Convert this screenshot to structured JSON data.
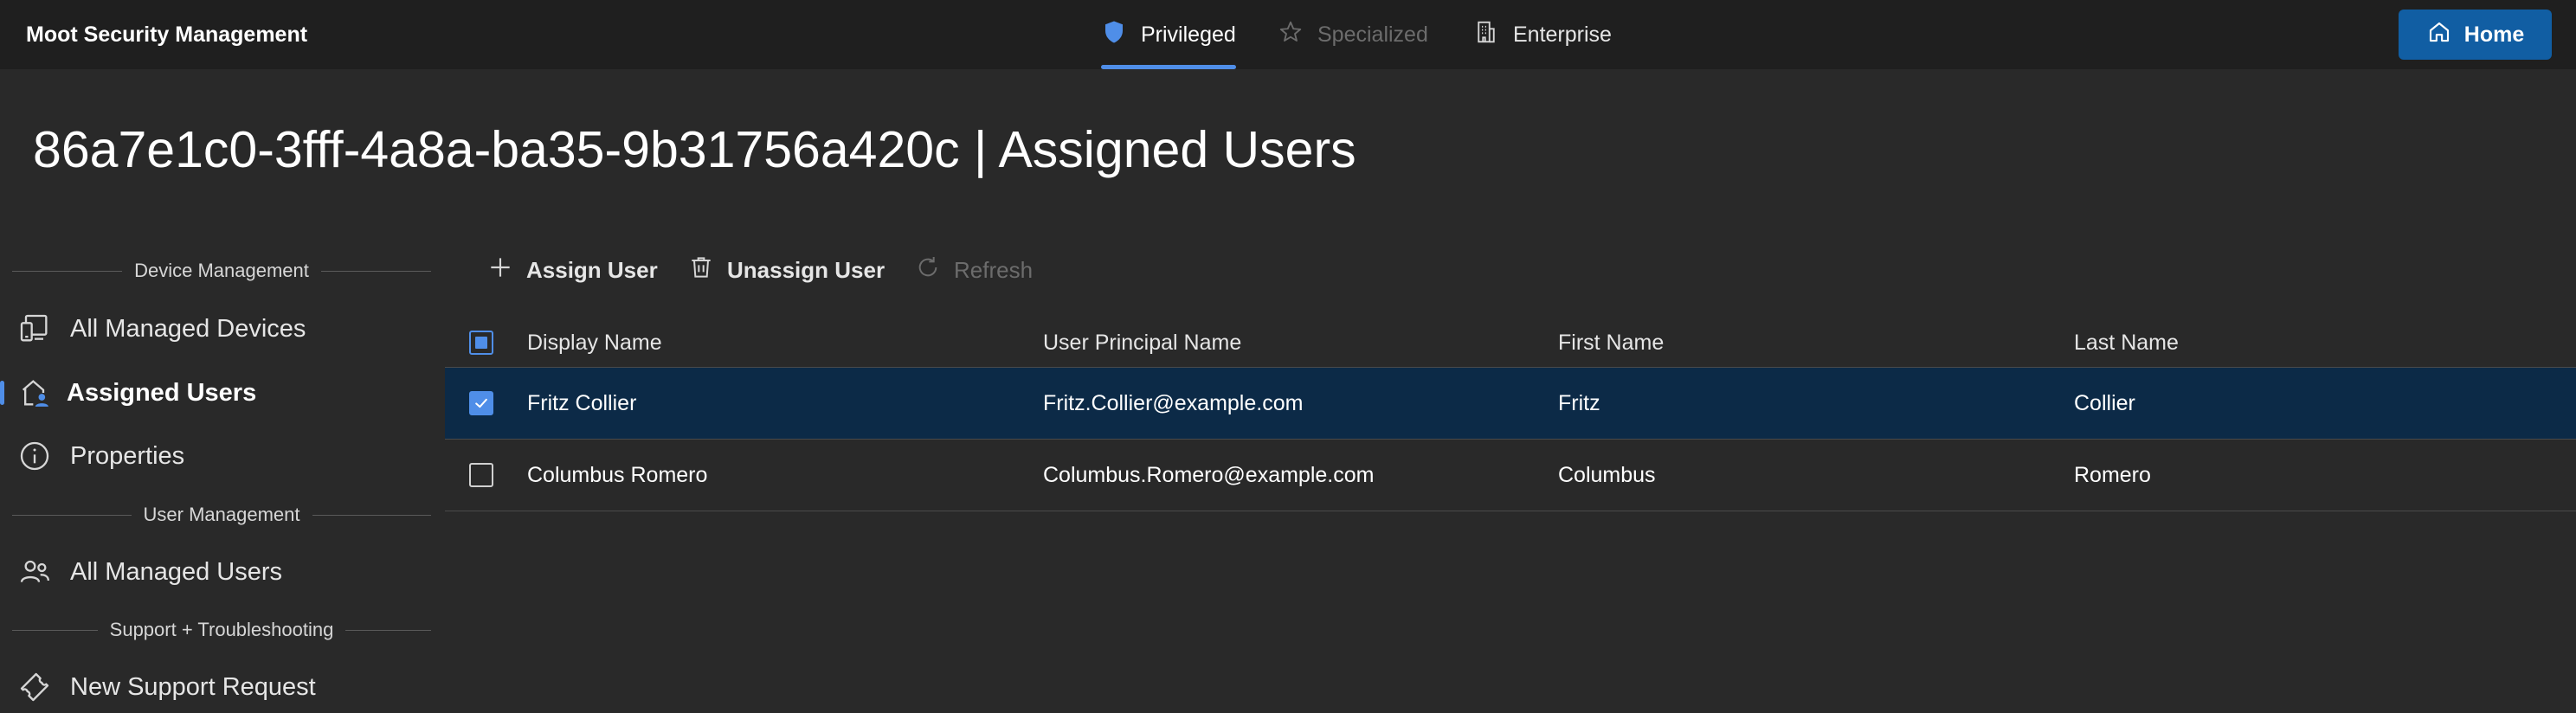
{
  "app": {
    "title": "Moot Security Management"
  },
  "tabs": [
    {
      "label": "Privileged",
      "state": "active",
      "icon": "shield-icon"
    },
    {
      "label": "Specialized",
      "state": "disabled",
      "icon": "star-icon"
    },
    {
      "label": "Enterprise",
      "state": "normal",
      "icon": "building-icon"
    }
  ],
  "home_button": {
    "label": "Home",
    "icon": "home-icon"
  },
  "page": {
    "title": "86a7e1c0-3fff-4a8a-ba35-9b31756a420c | Assigned Users"
  },
  "sidebar": {
    "sections": [
      {
        "label": "Device Management"
      },
      {
        "label": "User Management"
      },
      {
        "label": "Support + Troubleshooting"
      }
    ],
    "items": [
      {
        "label": "All Managed Devices",
        "icon": "devices-icon"
      },
      {
        "label": "Assigned Users",
        "icon": "home-person-icon",
        "selected": true
      },
      {
        "label": "Properties",
        "icon": "info-icon"
      },
      {
        "label": "All Managed Users",
        "icon": "people-icon"
      },
      {
        "label": "New Support Request",
        "icon": "ticket-icon"
      }
    ]
  },
  "toolbar": {
    "assign_label": "Assign User",
    "unassign_label": "Unassign User",
    "refresh_label": "Refresh"
  },
  "table": {
    "columns": [
      "Display Name",
      "User Principal Name",
      "First Name",
      "Last Name"
    ],
    "header_checkbox": "partial",
    "rows": [
      {
        "display_name": "Fritz Collier",
        "upn": "Fritz.Collier@example.com",
        "first_name": "Fritz",
        "last_name": "Collier",
        "checked": true
      },
      {
        "display_name": "Columbus Romero",
        "upn": "Columbus.Romero@example.com",
        "first_name": "Columbus",
        "last_name": "Romero",
        "checked": false
      }
    ]
  },
  "colors": {
    "accent": "#4f8ee8",
    "home_button": "#115ea3",
    "selected_row": "#0c2a47",
    "background": "#292929",
    "topbar": "#1f1f1f"
  }
}
